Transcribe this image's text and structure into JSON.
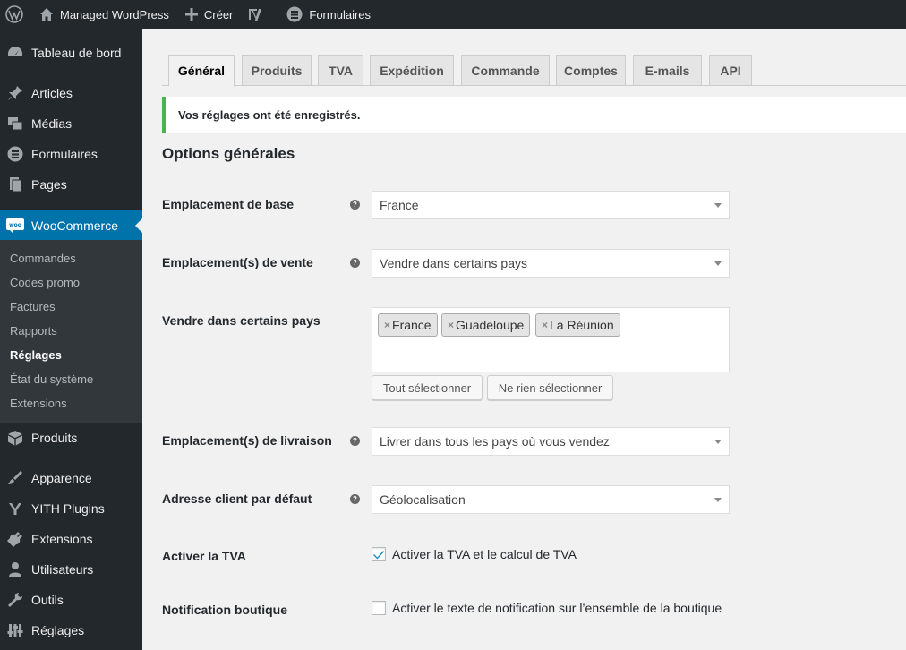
{
  "admin_bar": {
    "site_name": "Managed WordPress",
    "new_label": "Créer",
    "forms_label": "Formulaires"
  },
  "sidebar": {
    "items": [
      {
        "label": "Tableau de bord",
        "icon": "dashboard-icon"
      },
      {
        "label": "Articles",
        "icon": "pin-icon"
      },
      {
        "label": "Médias",
        "icon": "media-icon"
      },
      {
        "label": "Formulaires",
        "icon": "forms-icon"
      },
      {
        "label": "Pages",
        "icon": "pages-icon"
      },
      {
        "label": "WooCommerce",
        "icon": "woocommerce-icon",
        "active": true
      },
      {
        "label": "Produits",
        "icon": "box-icon"
      },
      {
        "label": "Apparence",
        "icon": "brush-icon"
      },
      {
        "label": "YITH Plugins",
        "icon": "yith-icon"
      },
      {
        "label": "Extensions",
        "icon": "plugin-icon"
      },
      {
        "label": "Utilisateurs",
        "icon": "users-icon"
      },
      {
        "label": "Outils",
        "icon": "wrench-icon"
      },
      {
        "label": "Réglages",
        "icon": "settings-icon"
      }
    ],
    "submenu": [
      {
        "label": "Commandes"
      },
      {
        "label": "Codes promo"
      },
      {
        "label": "Factures"
      },
      {
        "label": "Rapports"
      },
      {
        "label": "Réglages",
        "current": true
      },
      {
        "label": "État du système"
      },
      {
        "label": "Extensions"
      }
    ]
  },
  "tabs": [
    {
      "label": "Général",
      "active": true
    },
    {
      "label": "Produits"
    },
    {
      "label": "TVA"
    },
    {
      "label": "Expédition"
    },
    {
      "label": "Commande"
    },
    {
      "label": "Comptes"
    },
    {
      "label": "E-mails"
    },
    {
      "label": "API"
    }
  ],
  "notice": "Vos réglages ont été enregistrés.",
  "section_title": "Options générales",
  "fields": {
    "base_location": {
      "label": "Emplacement de base",
      "value": "France"
    },
    "selling_location": {
      "label": "Emplacement(s) de vente",
      "value": "Vendre dans certains pays"
    },
    "specific_countries": {
      "label": "Vendre dans certains pays",
      "chips": [
        "France",
        "Guadeloupe",
        "La Réunion"
      ],
      "select_all": "Tout sélectionner",
      "select_none": "Ne rien sélectionner"
    },
    "shipping_location": {
      "label": "Emplacement(s) de livraison",
      "value": "Livrer dans tous les pays où vous vendez"
    },
    "default_customer_address": {
      "label": "Adresse client par défaut",
      "value": "Géolocalisation"
    },
    "enable_tax": {
      "label": "Activer la TVA",
      "checkbox_label": "Activer la TVA et le calcul de TVA",
      "checked": true
    },
    "store_notice": {
      "label": "Notification boutique",
      "checkbox_label": "Activer le texte de notification sur l’ensemble de la boutique",
      "checked": false
    }
  },
  "colors": {
    "accent": "#0073aa",
    "sidebar": "#23282d",
    "success": "#46b450"
  }
}
